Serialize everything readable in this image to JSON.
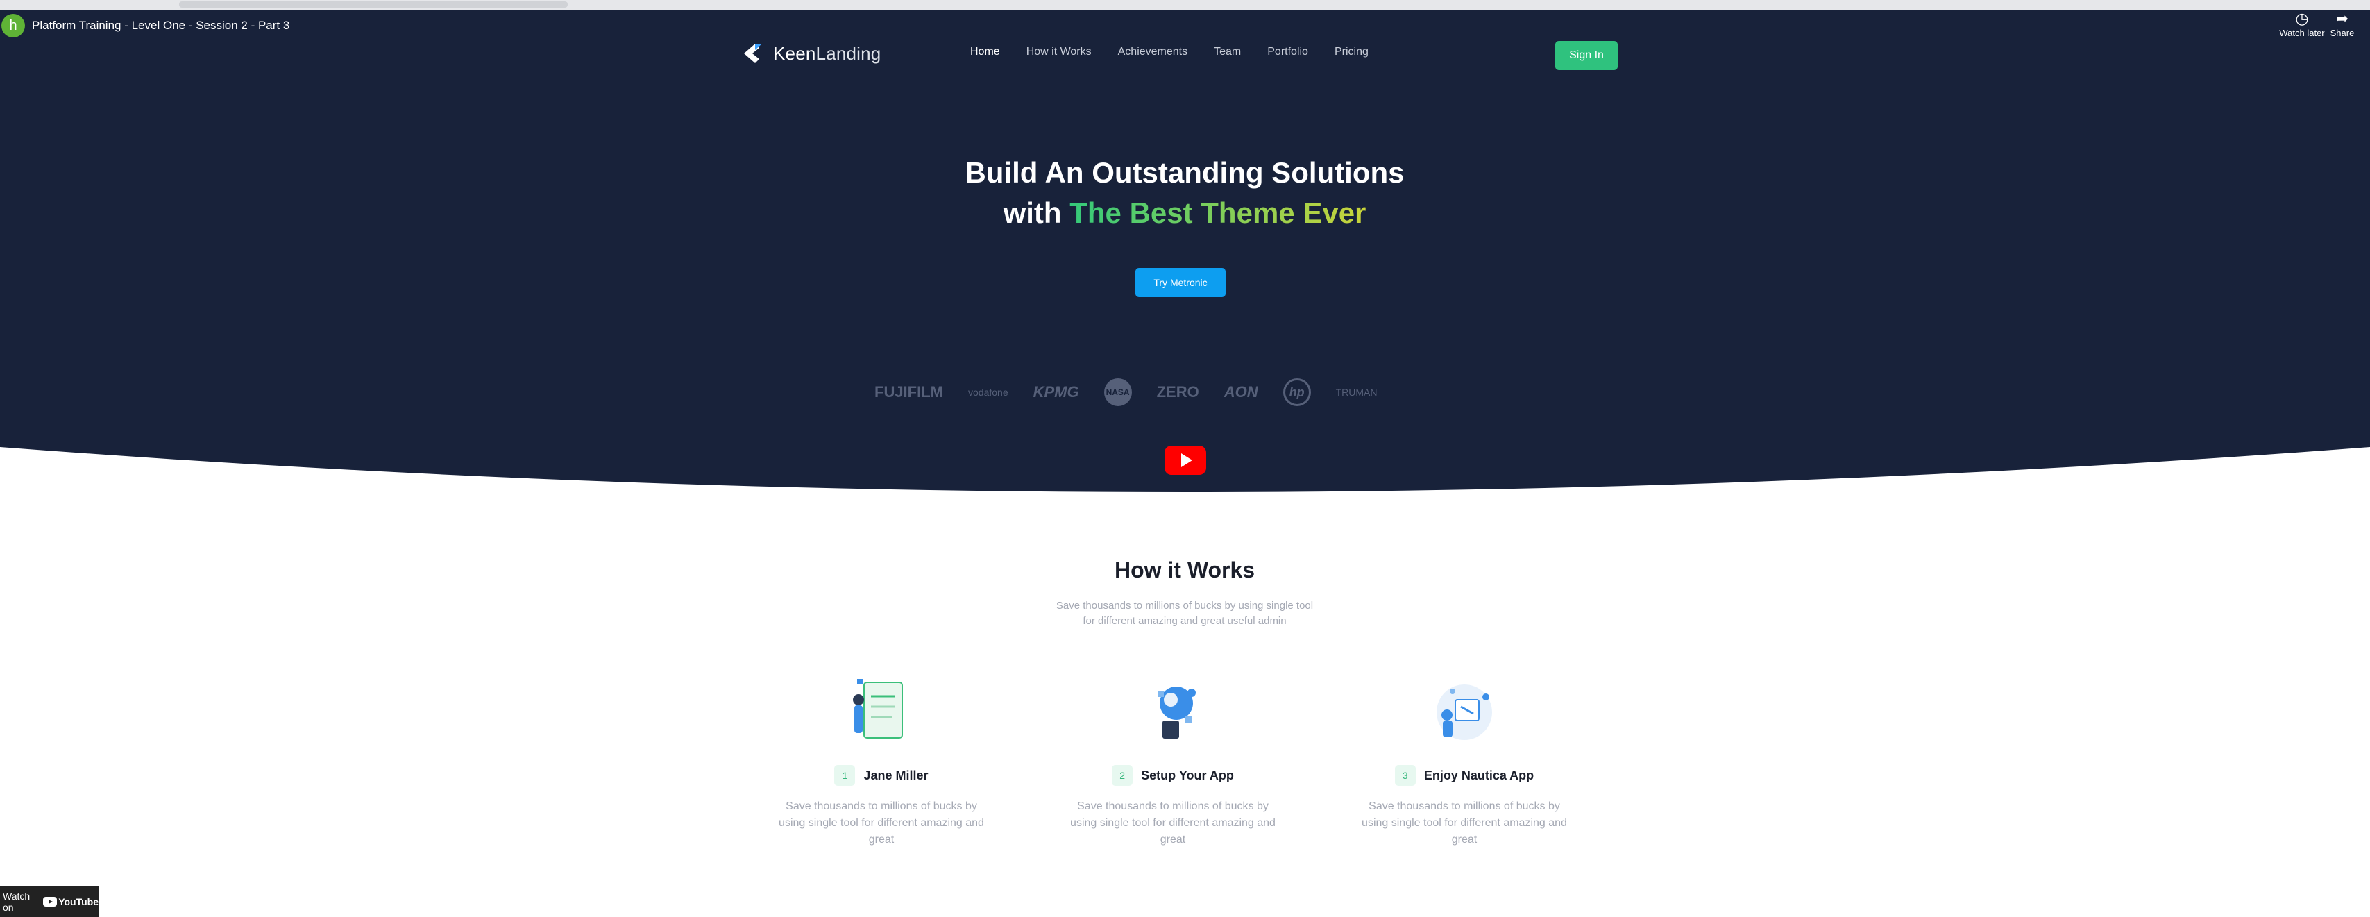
{
  "video": {
    "channel_initial": "h",
    "title": "Platform Training - Level One - Session 2 - Part 3",
    "watch_later": "Watch later",
    "share": "Share",
    "watch_on": "Watch on",
    "youtube": "YouTube"
  },
  "nav": {
    "brand_keen": "Keen",
    "brand_landing": "Landing",
    "items": [
      "Home",
      "How it Works",
      "Achievements",
      "Team",
      "Portfolio",
      "Pricing"
    ],
    "active": "Home",
    "signin": "Sign In"
  },
  "hero": {
    "line1": "Build An Outstanding Solutions",
    "line2_prefix": "with ",
    "line2_highlight": "The Best Theme Ever",
    "cta": "Try Metronic"
  },
  "brands": [
    "FUJIFILM",
    "vodafone",
    "KPMG",
    "NASA",
    "ZERO",
    "AON",
    "hp",
    "TRUMAN"
  ],
  "how": {
    "title": "How it Works",
    "subtitle_line1": "Save thousands to millions of bucks by using single tool",
    "subtitle_line2": "for different amazing and great useful admin",
    "steps": [
      {
        "num": "1",
        "label": "Jane Miller",
        "desc": "Save thousands to millions of bucks by using single tool for different amazing and great"
      },
      {
        "num": "2",
        "label": "Setup Your App",
        "desc": "Save thousands to millions of bucks by using single tool for different amazing and great"
      },
      {
        "num": "3",
        "label": "Enjoy Nautica App",
        "desc": "Save thousands to millions of bucks by using single tool for different amazing and great"
      }
    ]
  },
  "colors": {
    "hero_bg": "#18223a",
    "accent_green": "#2fc27e",
    "cta_blue": "#0d9ef0"
  }
}
